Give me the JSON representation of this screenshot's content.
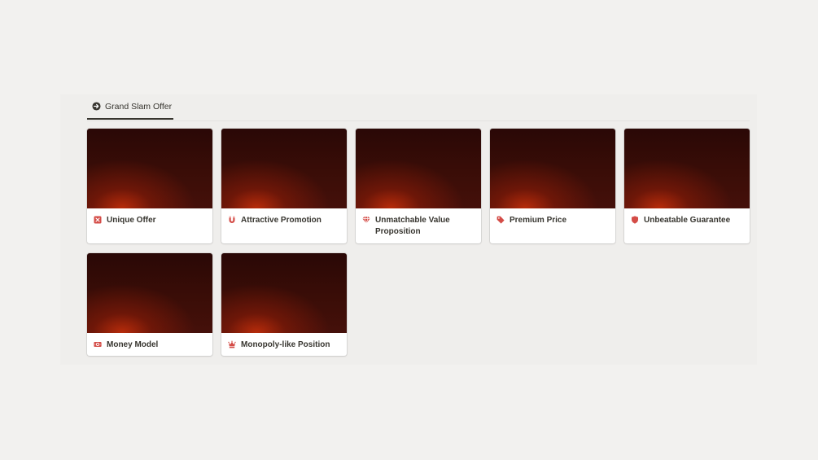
{
  "tabs": [
    {
      "label": "Grand Slam Offer",
      "icon": "arrow-circle-right-icon",
      "active": true
    }
  ],
  "cards": [
    {
      "title": "Unique Offer",
      "icon": "square-x-icon",
      "icon_color": "#d44c47"
    },
    {
      "title": "Attractive Promotion",
      "icon": "magnet-icon",
      "icon_color": "#d44c47"
    },
    {
      "title": "Unmatchable Value Proposition",
      "icon": "diamond-icon",
      "icon_color": "#d44c47"
    },
    {
      "title": "Premium Price",
      "icon": "tag-icon",
      "icon_color": "#d44c47"
    },
    {
      "title": "Unbeatable Guarantee",
      "icon": "shield-icon",
      "icon_color": "#d44c47"
    },
    {
      "title": "Money Model",
      "icon": "banknote-icon",
      "icon_color": "#d44c47"
    },
    {
      "title": "Monopoly-like Position",
      "icon": "crown-icon",
      "icon_color": "#d44c47"
    }
  ]
}
